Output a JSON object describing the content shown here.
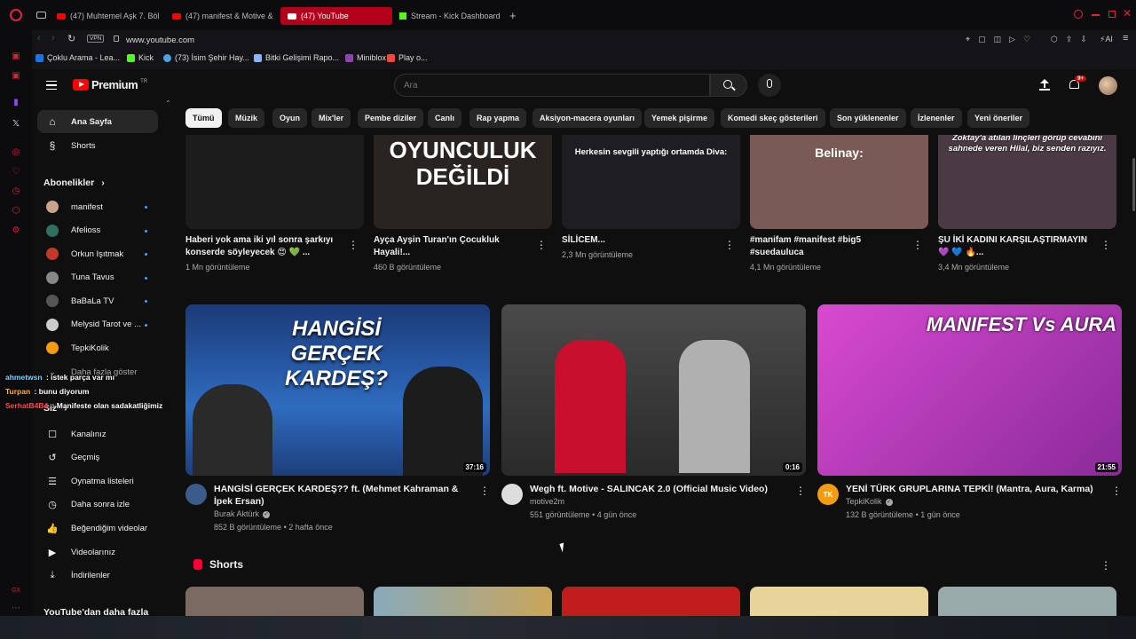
{
  "browser": {
    "tabs": [
      {
        "label": "(47) Muhtemel Aşk 7. Bölü",
        "icon": "youtube-icon"
      },
      {
        "label": "(47) manifest & Motive & P",
        "icon": "youtube-icon"
      },
      {
        "label": "(47) YouTube",
        "icon": "youtube-icon",
        "active": true
      },
      {
        "label": "Stream - Kick Dashboard",
        "icon": "kick-icon"
      }
    ],
    "address_badge": "VPN",
    "url": "www.youtube.com",
    "ai_label": "AI",
    "bookmarks": [
      {
        "label": "Çoklu Arama - Lea...",
        "color": "#1a73e8"
      },
      {
        "label": "Kick",
        "color": "#53fc18"
      },
      {
        "label": "(73) İsim Şehir Hay...",
        "color": "#4aa3df"
      },
      {
        "label": "Bitki Gelişimi Rapo...",
        "color": "#8ab4f8"
      },
      {
        "label": "Miniblox",
        "color": "#8e44ad"
      },
      {
        "label": "Play o...",
        "color": "#e74c3c"
      }
    ]
  },
  "youtube": {
    "logo_text": "Premium",
    "logo_region": "TR",
    "search_placeholder": "Ara",
    "notification_count": "9+",
    "chips": [
      "Tümü",
      "Müzik",
      "Oyun",
      "Mix'ler",
      "Pembe diziler",
      "Canlı",
      "Rap yapma",
      "Aksiyon-macera oyunları",
      "Yemek pişirme",
      "Komedi skeç gösterileri",
      "Son yüklenenler",
      "İzlenenler",
      "Yeni öneriler"
    ],
    "sidebar": {
      "main": [
        {
          "label": "Ana Sayfa",
          "icon": "home-icon",
          "active": true
        },
        {
          "label": "Shorts",
          "icon": "shorts-icon"
        }
      ],
      "subs_heading": "Abonelikler",
      "subscriptions": [
        {
          "label": "manifest",
          "color": "#c9a38a"
        },
        {
          "label": "Afelioss",
          "color": "#2f6f5f"
        },
        {
          "label": "Orkun Işıtmak",
          "color": "#c0392b"
        },
        {
          "label": "Tuna Tavus",
          "color": "#888888"
        },
        {
          "label": "BaBaLa TV",
          "color": "#555555"
        },
        {
          "label": "Melysid Tarot ve ...",
          "color": "#cccccc"
        },
        {
          "label": "TepkiKolik",
          "color": "#f39c12"
        }
      ],
      "show_more": "Daha fazla göster",
      "you_heading": "Siz",
      "you_items": [
        {
          "label": "Kanalınız",
          "icon": "channel-icon"
        },
        {
          "label": "Geçmiş",
          "icon": "history-icon"
        },
        {
          "label": "Oynatma listeleri",
          "icon": "playlist-icon"
        },
        {
          "label": "Daha sonra izle",
          "icon": "clock-icon"
        },
        {
          "label": "Beğendiğim videolar",
          "icon": "like-icon"
        },
        {
          "label": "Videolarınız",
          "icon": "video-icon"
        },
        {
          "label": "İndirilenler",
          "icon": "download-icon"
        }
      ],
      "more_heading": "YouTube'dan daha fazla"
    },
    "top_row": [
      {
        "thumb_text": "",
        "title": "Haberi yok ama iki yıl sonra şarkıyı konserde söyleyecek 😍 💚 ...",
        "views": "1 Mn görüntüleme",
        "bg": "#1c1c1c"
      },
      {
        "thumb_text": "OYUNCULUK DEĞİLDİ",
        "title": "Ayça Ayşin Turan'ın Çocukluk Hayali!...",
        "views": "460 B görüntüleme",
        "bg": "#2a2420"
      },
      {
        "thumb_text": "Herkesin sevgili yaptığı ortamda Diva:",
        "title": "SİLİCEM...",
        "views": "2,3 Mn görüntüleme",
        "bg": "#1e1e22"
      },
      {
        "thumb_text": "Belinay:",
        "title": "#manifam #manifest #big5 #suedauluca",
        "views": "4,1 Mn görüntüleme",
        "bg": "#7a5a55"
      },
      {
        "thumb_text": "Zoktay'a atılan linçleri görüp cevabını sahnede veren Hilal, biz senden razıyız.",
        "title": "ŞU İKİ KADINI KARŞILAŞTIRMAYIN 💜 💙 🔥...",
        "views": "3,4 Mn görüntüleme",
        "bg": "#4a3a44"
      }
    ],
    "videos": [
      {
        "thumb_text": "HANGİSİ GERÇEK KARDEŞ?",
        "duration": "37:16",
        "title": "HANGİSİ GERÇEK KARDEŞ?? ft. (Mehmet Kahraman & İpek Ersan)",
        "channel": "Burak Aktürk",
        "views": "852 B görüntüleme",
        "age": "2 hafta önce",
        "avatar": "#3b5b8a",
        "bg": "#1f4f8f"
      },
      {
        "thumb_text": "",
        "duration": "0:16",
        "title": "Wegh ft. Motive - SALINCAK 2.0 (Official Music Video)",
        "channel": "motive2m",
        "views": "551 görüntüleme",
        "age": "4 gün önce",
        "avatar": "#dddddd",
        "bg": "#3a3a3a"
      },
      {
        "thumb_text": "MANIFEST Vs AURA",
        "duration": "21:55",
        "title": "YENİ TÜRK GRUPLARINA TEPKİ! (Mantra, Aura, Karma)",
        "channel": "TepkiKolik",
        "views": "132 B görüntüleme",
        "age": "1 gün önce",
        "avatar": "#f39c12",
        "avatar_text": "TK",
        "bg": "#b03ab5"
      }
    ],
    "shorts_heading": "Shorts"
  },
  "chat": [
    {
      "user": "ahmetwsn",
      "sep": " : ",
      "text": "istek parça var mı",
      "color": "#7fd4ff"
    },
    {
      "user": "Turpan",
      "sep": " : ",
      "text": "bunu diyorum",
      "color": "#ffb347"
    },
    {
      "user": "SerhatB4B4",
      "sep": " : ",
      "text": "Manifeste olan sadakatliğimiz",
      "color": "#ff4d4d"
    }
  ],
  "colors": {
    "accent": "#ff0000",
    "active_tab": "#b3001b",
    "verified": "#aaaaaa",
    "sub_dot": "#3ea6ff"
  }
}
